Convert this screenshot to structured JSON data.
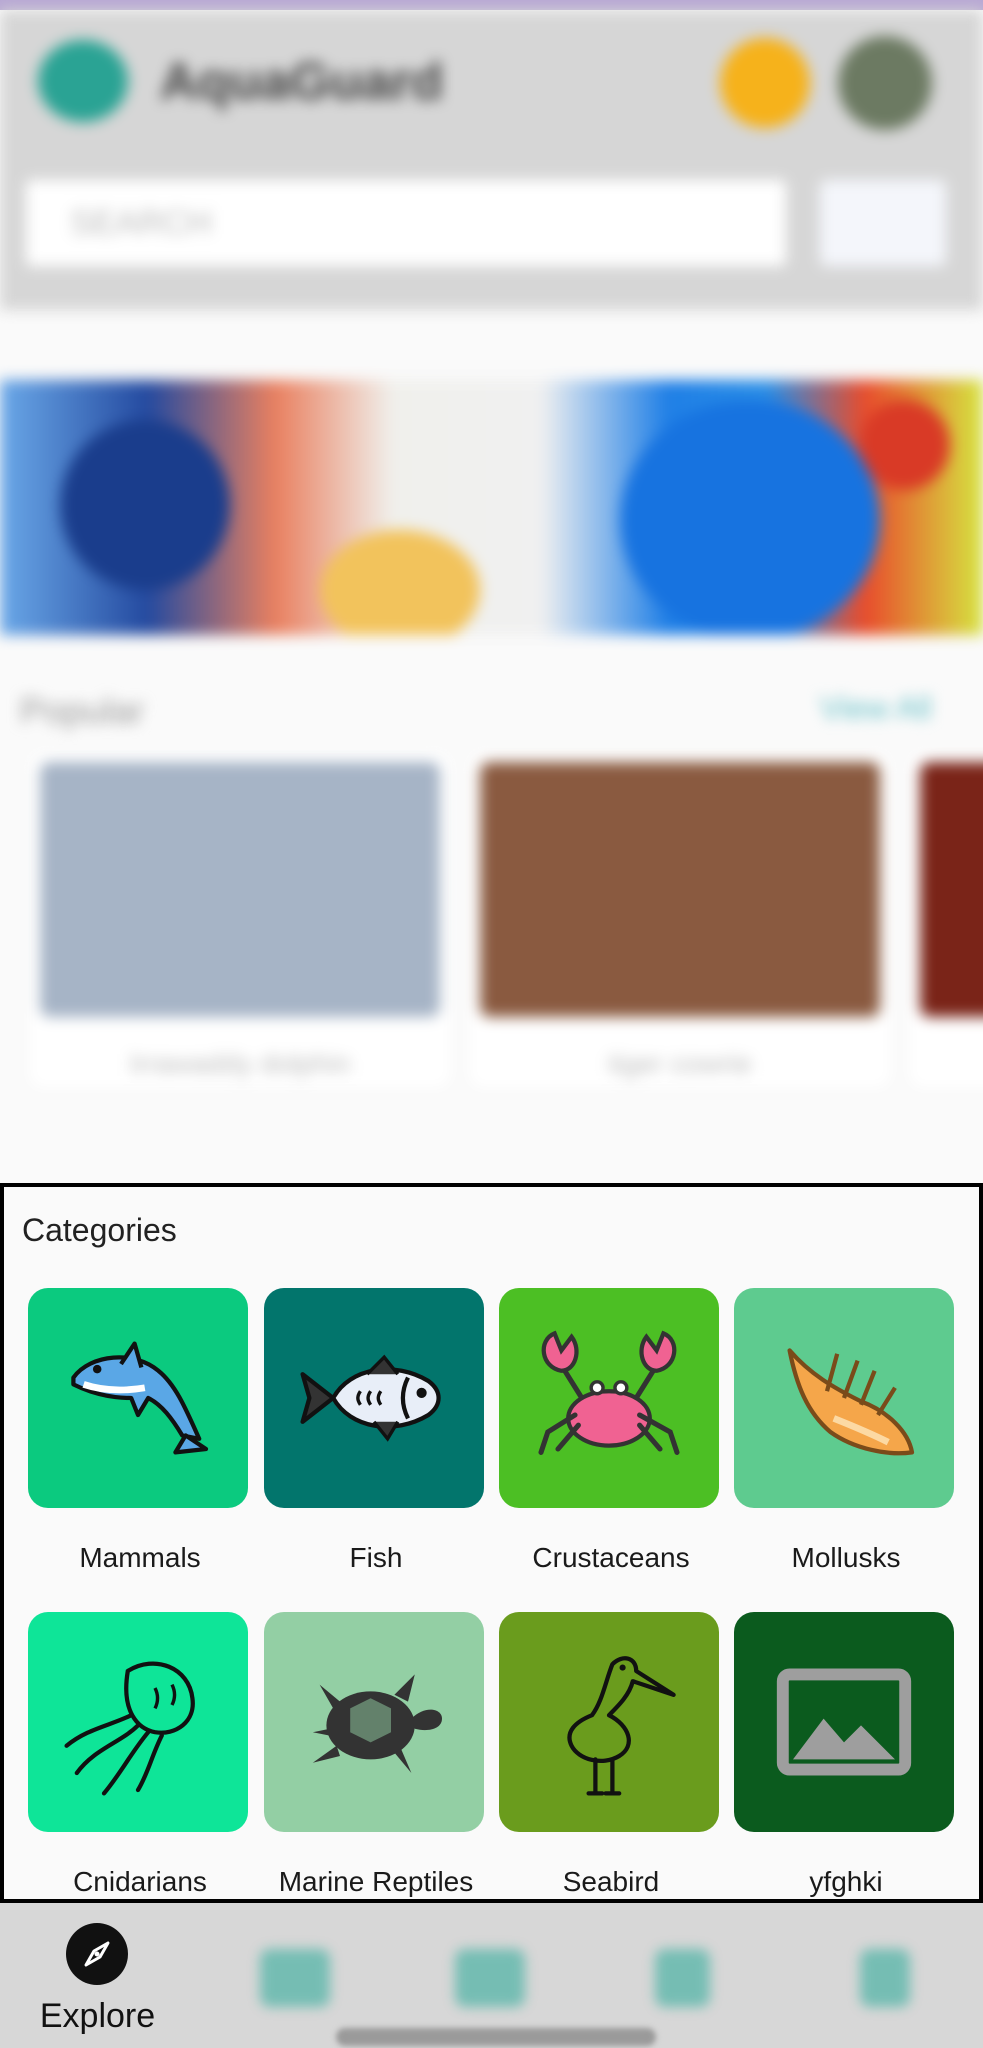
{
  "app": {
    "name": "AquaGuard"
  },
  "search": {
    "placeholder": "SEARCH"
  },
  "popular": {
    "title": "Popular",
    "view_all": "View All",
    "cards": [
      {
        "caption": "Irrawaddy dolphin"
      },
      {
        "caption": "tiger cowrie"
      }
    ]
  },
  "categories": {
    "title": "Categories",
    "items": [
      {
        "label": "Mammals",
        "color": "#0bca7f",
        "icon": "dolphin-icon"
      },
      {
        "label": "Fish",
        "color": "#02756c",
        "icon": "fish-icon"
      },
      {
        "label": "Crustaceans",
        "color": "#4cbf24",
        "icon": "crab-icon"
      },
      {
        "label": "Mollusks",
        "color": "#5ecb8f",
        "icon": "seashell-icon"
      },
      {
        "label": "Cnidarians",
        "color": "#0ee598",
        "icon": "jellyfish-icon"
      },
      {
        "label": "Marine Reptiles",
        "color": "#93cfa4",
        "icon": "turtle-icon"
      },
      {
        "label": "Seabird",
        "color": "#6a9c1d",
        "icon": "heron-icon"
      },
      {
        "label": "yfghki",
        "color": "#0b5b1e",
        "icon": "image-placeholder-icon"
      }
    ]
  },
  "bottom_nav": {
    "active_label": "Explore",
    "active_icon": "compass-icon"
  }
}
